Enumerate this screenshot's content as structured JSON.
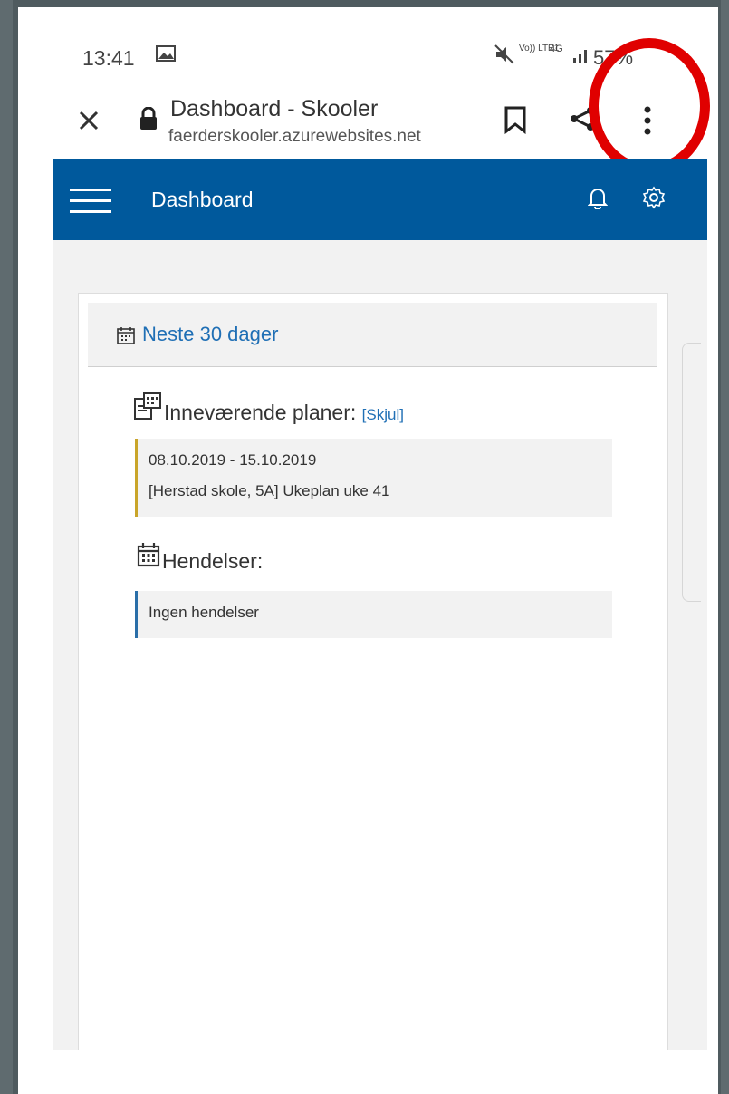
{
  "status": {
    "time": "13:41",
    "network": "Vo)) LTE1",
    "gen": "4G",
    "battery": "57%"
  },
  "browser": {
    "title": "Dashboard - Skooler",
    "url": "faerderskooler.azurewebsites.net"
  },
  "app": {
    "title": "Dashboard"
  },
  "card": {
    "header": "Neste 30 dager",
    "plans_label": "Inneværende planer:",
    "plans_toggle": "[Skjul]",
    "plan": {
      "dates": "08.10.2019 - 15.10.2019",
      "name": "[Herstad skole, 5A] Ukeplan uke 41"
    },
    "events_label": "Hendelser:",
    "no_events": "Ingen hendelser"
  },
  "colors": {
    "app_bar": "#00599c",
    "link": "#1f6fb5",
    "plan_accent": "#c9a52a",
    "event_accent": "#2a6ea8",
    "annotation": "#e00000"
  }
}
